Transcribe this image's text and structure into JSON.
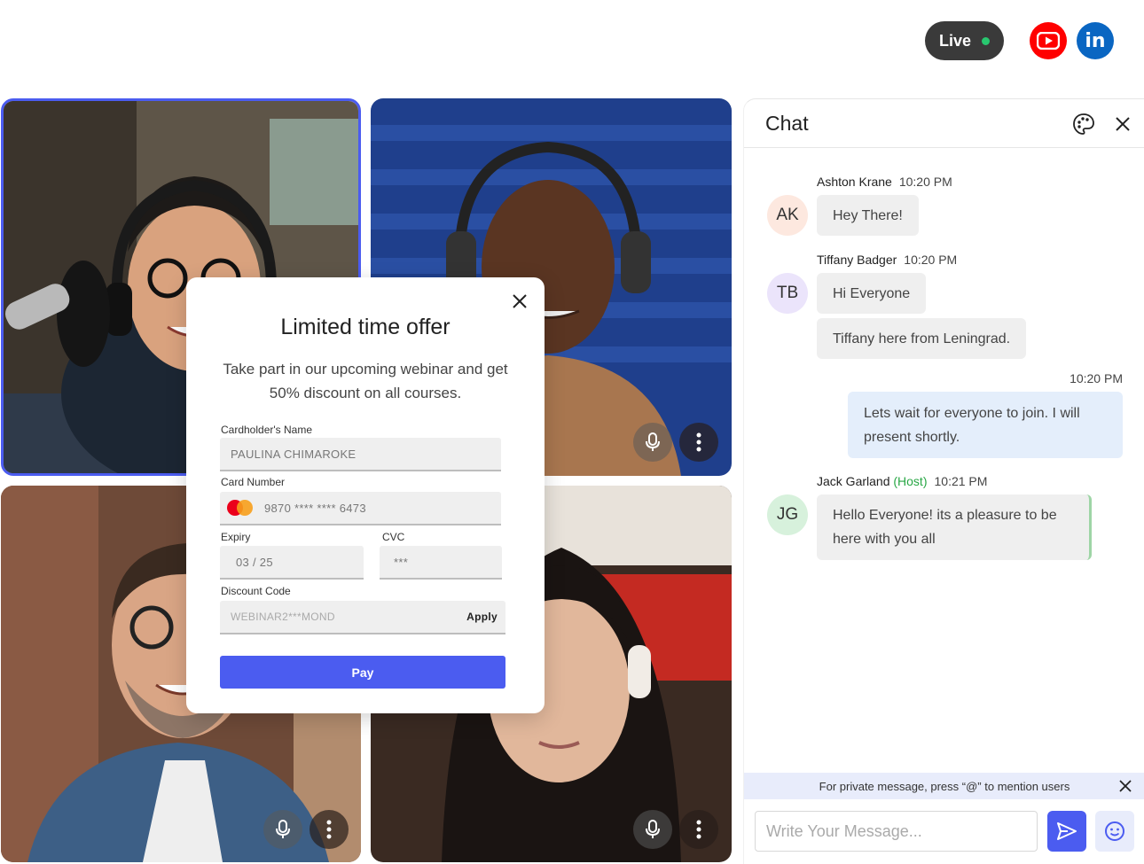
{
  "topbar": {
    "live_label": "Live",
    "social": [
      {
        "name": "youtube-icon",
        "color": "#ff0000"
      },
      {
        "name": "linkedin-icon",
        "color": "#0a66c2",
        "glyph": "in"
      }
    ]
  },
  "colors": {
    "accent": "#4b5cf0",
    "live_dot": "#28c76f",
    "host": "#28a745"
  },
  "offer_modal": {
    "title": "Limited time offer",
    "subtitle": "Take part in our upcoming webinar and get 50% discount on all courses.",
    "cardholder_label": "Cardholder's Name",
    "cardholder_value": "PAULINA CHIMAROKE",
    "card_number_label": "Card Number",
    "card_number_value": "9870 **** **** 6473",
    "expiry_label": "Expiry",
    "expiry_value": "03 / 25",
    "cvc_label": "CVC",
    "cvc_value": "***",
    "discount_label": "Discount Code",
    "discount_value": "WEBINAR2***MOND",
    "apply_label": "Apply",
    "pay_label": "Pay"
  },
  "chat": {
    "title": "Chat",
    "messages": [
      {
        "author": "Ashton Krane",
        "time": "10:20 PM",
        "initials": "AK",
        "avatar_color": "#fde8df",
        "text": "Hey There!"
      },
      {
        "author": "Tiffany Badger",
        "time": "10:20 PM",
        "initials": "TB",
        "avatar_color": "#ebe4fb",
        "texts": [
          "Hi Everyone",
          "Tiffany here from Leningrad."
        ]
      },
      {
        "own": true,
        "time": "10:20 PM",
        "text": "Lets wait for everyone to join. I will present shortly."
      },
      {
        "author": "Jack Garland",
        "role": "(Host)",
        "time": "10:21 PM",
        "initials": "JG",
        "avatar_color": "#d7f1dc",
        "text": "Hello Everyone! its a pleasure to be here with you all"
      }
    ],
    "hint": "For private message, press “@” to mention users",
    "input_placeholder": "Write Your Message..."
  }
}
